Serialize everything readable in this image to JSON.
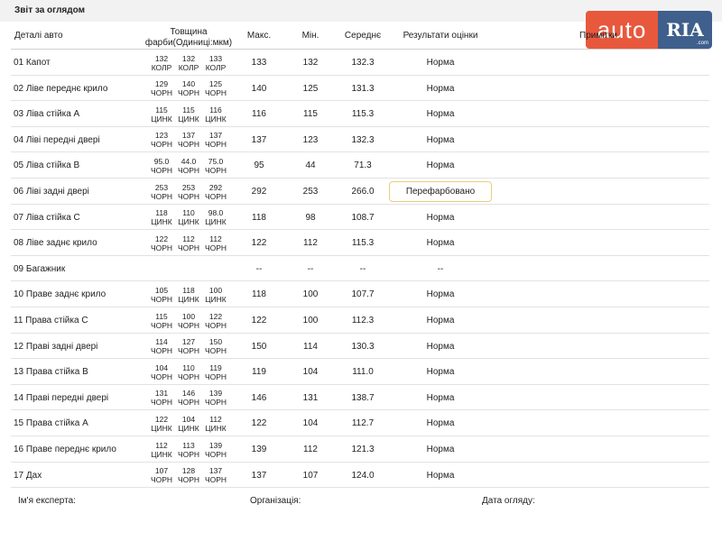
{
  "report": {
    "title": "Звіт за оглядом"
  },
  "logo": {
    "auto": "auto",
    "ria": "RIA",
    "domain": ".com"
  },
  "headers": {
    "detail": "Деталі авто",
    "thickness_1": "Товщина",
    "thickness_2": "фарби(Одиниці:мкм)",
    "max": "Макс.",
    "min": "Мін.",
    "avg": "Середнє",
    "results": "Результати оцінки",
    "notes": "Примітки"
  },
  "rows": [
    {
      "name": "01  Капот",
      "t": [
        [
          "132",
          "КОЛР"
        ],
        [
          "132",
          "КОЛР"
        ],
        [
          "133",
          "КОЛР"
        ]
      ],
      "max": "133",
      "min": "132",
      "avg": "132.3",
      "result": "Норма",
      "flag": false
    },
    {
      "name": "02  Ліве переднє крило",
      "t": [
        [
          "129",
          "ЧОРН"
        ],
        [
          "140",
          "ЧОРН"
        ],
        [
          "125",
          "ЧОРН"
        ]
      ],
      "max": "140",
      "min": "125",
      "avg": "131.3",
      "result": "Норма",
      "flag": false
    },
    {
      "name": "03  Ліва стійка A",
      "t": [
        [
          "115",
          "ЦИНК"
        ],
        [
          "115",
          "ЦИНК"
        ],
        [
          "116",
          "ЦИНК"
        ]
      ],
      "max": "116",
      "min": "115",
      "avg": "115.3",
      "result": "Норма",
      "flag": false
    },
    {
      "name": "04  Ліві передні двері",
      "t": [
        [
          "123",
          "ЧОРН"
        ],
        [
          "137",
          "ЧОРН"
        ],
        [
          "137",
          "ЧОРН"
        ]
      ],
      "max": "137",
      "min": "123",
      "avg": "132.3",
      "result": "Норма",
      "flag": false
    },
    {
      "name": "05  Ліва стійка B",
      "t": [
        [
          "95.0",
          "ЧОРН"
        ],
        [
          "44.0",
          "ЧОРН"
        ],
        [
          "75.0",
          "ЧОРН"
        ]
      ],
      "max": "95",
      "min": "44",
      "avg": "71.3",
      "result": "Норма",
      "flag": false
    },
    {
      "name": "06  Ліві задні двері",
      "t": [
        [
          "253",
          "ЧОРН"
        ],
        [
          "253",
          "ЧОРН"
        ],
        [
          "292",
          "ЧОРН"
        ]
      ],
      "max": "292",
      "min": "253",
      "avg": "266.0",
      "result": "Перефарбовано",
      "flag": true
    },
    {
      "name": "07  Ліва стійка C",
      "t": [
        [
          "118",
          "ЦИНК"
        ],
        [
          "110",
          "ЦИНК"
        ],
        [
          "98.0",
          "ЦИНК"
        ]
      ],
      "max": "118",
      "min": "98",
      "avg": "108.7",
      "result": "Норма",
      "flag": false
    },
    {
      "name": "08  Ліве заднє крило",
      "t": [
        [
          "122",
          "ЧОРН"
        ],
        [
          "112",
          "ЧОРН"
        ],
        [
          "112",
          "ЧОРН"
        ]
      ],
      "max": "122",
      "min": "112",
      "avg": "115.3",
      "result": "Норма",
      "flag": false
    },
    {
      "name": "09  Багажник",
      "t": [
        [
          "",
          ""
        ],
        [
          "",
          ""
        ],
        [
          "",
          ""
        ]
      ],
      "max": "--",
      "min": "--",
      "avg": "--",
      "result": "--",
      "flag": false
    },
    {
      "name": "10  Праве заднє крило",
      "t": [
        [
          "105",
          "ЧОРН"
        ],
        [
          "118",
          "ЦИНК"
        ],
        [
          "100",
          "ЦИНК"
        ]
      ],
      "max": "118",
      "min": "100",
      "avg": "107.7",
      "result": "Норма",
      "flag": false
    },
    {
      "name": "11  Права стійка C",
      "t": [
        [
          "115",
          "ЧОРН"
        ],
        [
          "100",
          "ЧОРН"
        ],
        [
          "122",
          "ЧОРН"
        ]
      ],
      "max": "122",
      "min": "100",
      "avg": "112.3",
      "result": "Норма",
      "flag": false
    },
    {
      "name": "12  Праві задні двері",
      "t": [
        [
          "114",
          "ЧОРН"
        ],
        [
          "127",
          "ЧОРН"
        ],
        [
          "150",
          "ЧОРН"
        ]
      ],
      "max": "150",
      "min": "114",
      "avg": "130.3",
      "result": "Норма",
      "flag": false
    },
    {
      "name": "13  Права стійка B",
      "t": [
        [
          "104",
          "ЧОРН"
        ],
        [
          "110",
          "ЧОРН"
        ],
        [
          "119",
          "ЧОРН"
        ]
      ],
      "max": "119",
      "min": "104",
      "avg": "111.0",
      "result": "Норма",
      "flag": false
    },
    {
      "name": "14  Праві передні двері",
      "t": [
        [
          "131",
          "ЧОРН"
        ],
        [
          "146",
          "ЧОРН"
        ],
        [
          "139",
          "ЧОРН"
        ]
      ],
      "max": "146",
      "min": "131",
      "avg": "138.7",
      "result": "Норма",
      "flag": false
    },
    {
      "name": "15  Права стійка A",
      "t": [
        [
          "122",
          "ЦИНК"
        ],
        [
          "104",
          "ЦИНК"
        ],
        [
          "112",
          "ЦИНК"
        ]
      ],
      "max": "122",
      "min": "104",
      "avg": "112.7",
      "result": "Норма",
      "flag": false
    },
    {
      "name": "16  Праве переднє крило",
      "t": [
        [
          "112",
          "ЦИНК"
        ],
        [
          "113",
          "ЧОРН"
        ],
        [
          "139",
          "ЧОРН"
        ]
      ],
      "max": "139",
      "min": "112",
      "avg": "121.3",
      "result": "Норма",
      "flag": false
    },
    {
      "name": "17  Дах",
      "t": [
        [
          "107",
          "ЧОРН"
        ],
        [
          "128",
          "ЧОРН"
        ],
        [
          "137",
          "ЧОРН"
        ]
      ],
      "max": "137",
      "min": "107",
      "avg": "124.0",
      "result": "Норма",
      "flag": false
    }
  ],
  "footer": {
    "expert": "Ім'я експерта:",
    "organization": "Організація:",
    "date": "Дата огляду:"
  },
  "colors": {
    "flag_border": "#e9cf7a",
    "logo_auto": "#e8583d",
    "logo_ria": "#3f5f8c"
  }
}
